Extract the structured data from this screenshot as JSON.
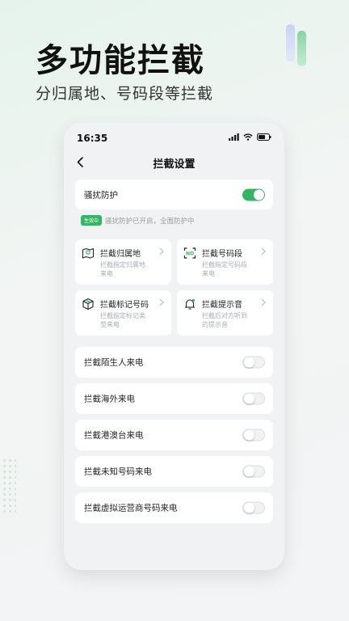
{
  "promo": {
    "headline": "多功能拦截",
    "subline": "分归属地、号码段等拦截"
  },
  "phone": {
    "status": {
      "time": "16:35"
    },
    "nav": {
      "title": "拦截设置"
    },
    "protection": {
      "label": "骚扰防护",
      "enabled": true,
      "badge": "生效中",
      "note": "骚扰防护已开启，全面防护中"
    },
    "tiles": [
      {
        "title": "拦截归属地",
        "desc": "拦截指定归属地来电",
        "icon": "map-pin-icon"
      },
      {
        "title": "拦截号码段",
        "desc": "拦截指定号码段来电",
        "icon": "number-scan-icon"
      },
      {
        "title": "拦截标记号码",
        "desc": "拦截指定标记类型来电",
        "icon": "box-tag-icon"
      },
      {
        "title": "拦截提示音",
        "desc": "拦截后对方听到的提示音",
        "icon": "bell-icon"
      }
    ],
    "toggles": [
      {
        "label": "拦截陌生人来电",
        "enabled": false
      },
      {
        "label": "拦截海外来电",
        "enabled": false
      },
      {
        "label": "拦截港澳台来电",
        "enabled": false
      },
      {
        "label": "拦截未知号码来电",
        "enabled": false
      },
      {
        "label": "拦截虚拟运营商号码来电",
        "enabled": false
      }
    ]
  },
  "colors": {
    "accent": "#34b561",
    "background": "#f1f2f4"
  }
}
